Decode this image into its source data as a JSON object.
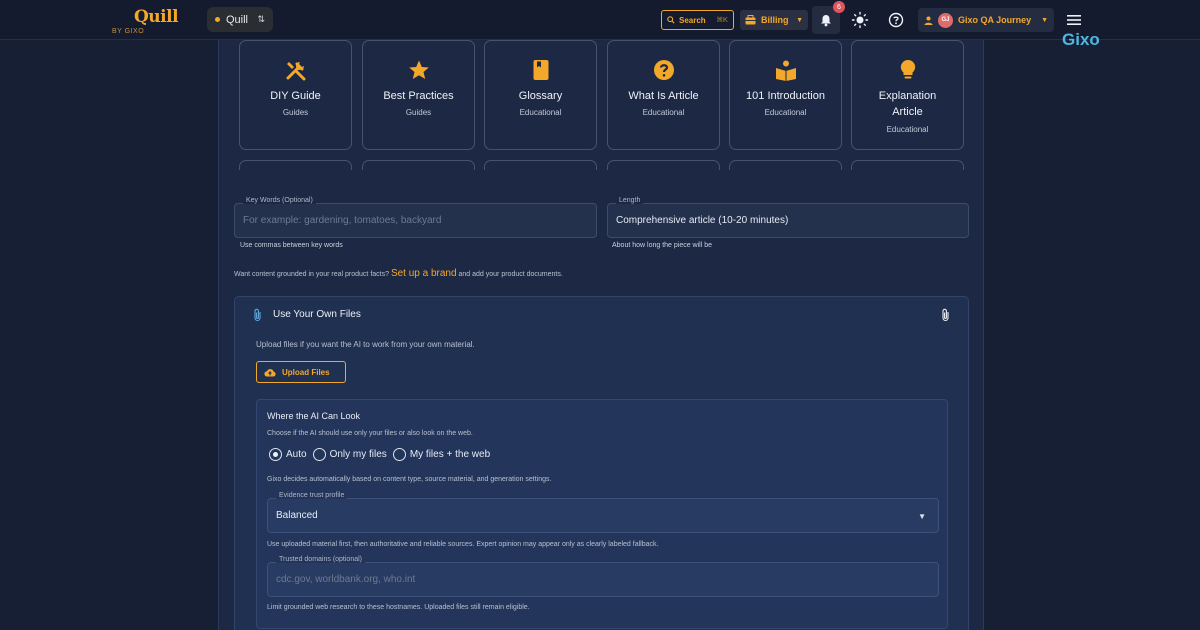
{
  "header": {
    "logo": "Quill",
    "logo_sub": "BY GIXO",
    "workspace": "Quill",
    "search_label": "Search",
    "search_shortcut": "⌘K",
    "billing_label": "Billing",
    "notification_count": "6",
    "user_initials": "GJ",
    "user_name": "Gixo QA Journey",
    "brand_label": "Gixo",
    "accent_color": "#f4a82a"
  },
  "article_types": [
    {
      "title": "DIY Guide",
      "category": "Guides",
      "icon": "tools-icon"
    },
    {
      "title": "Best Practices",
      "category": "Guides",
      "icon": "star-icon"
    },
    {
      "title": "Glossary",
      "category": "Educational",
      "icon": "book-icon"
    },
    {
      "title": "What Is Article",
      "category": "Educational",
      "icon": "question-icon"
    },
    {
      "title": "101 Introduction",
      "category": "Educational",
      "icon": "reader-icon"
    },
    {
      "title": "Explanation Article",
      "category": "Educational",
      "icon": "lightbulb-icon"
    }
  ],
  "keywords": {
    "label": "Key Words (Optional)",
    "placeholder": "For example: gardening, tomatoes, backyard",
    "helper": "Use commas between key words"
  },
  "length": {
    "label": "Length",
    "value": "Comprehensive article (10-20 minutes)",
    "helper": "About how long the piece will be"
  },
  "grounding": {
    "prefix": "Want content grounded in your real product facts?",
    "link": "Set up a brand",
    "suffix": "and add your product documents."
  },
  "files": {
    "title": "Use Your Own Files",
    "description": "Upload files if you want the AI to work from your own material.",
    "upload_label": "Upload Files",
    "where": {
      "title": "Where the AI Can Look",
      "description": "Choose if the AI should use only your files or also look on the web.",
      "options": [
        {
          "label": "Auto",
          "selected": true
        },
        {
          "label": "Only my files",
          "selected": false
        },
        {
          "label": "My files + the web",
          "selected": false
        }
      ],
      "mode_note": "Gixo decides automatically based on content type, source material, and generation settings.",
      "trust_label": "Evidence trust profile",
      "trust_value": "Balanced",
      "trust_note": "Use uploaded material first, then authoritative and reliable sources. Expert opinion may appear only as clearly labeled fallback.",
      "domains_label": "Trusted domains (optional)",
      "domains_placeholder": "cdc.gov, worldbank.org, who.int",
      "domains_note": "Limit grounded web research to these hostnames. Uploaded files still remain eligible."
    }
  }
}
